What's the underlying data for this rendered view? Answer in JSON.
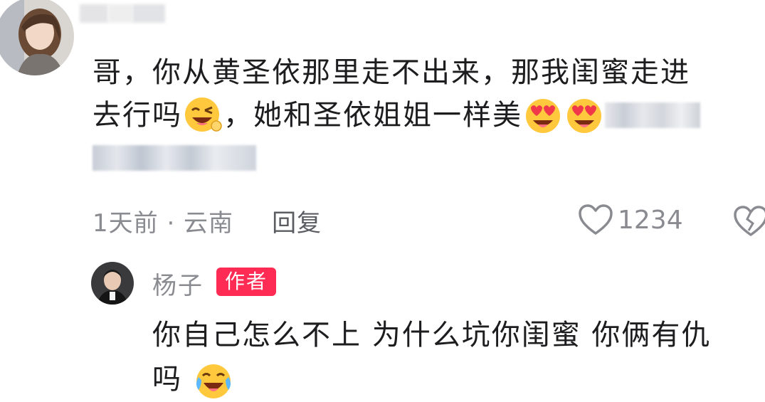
{
  "comment": {
    "avatar_icon": "user-avatar",
    "username_blurred": "",
    "text_line1": "哥，你从黄圣依那里走不出来，那我闺蜜走进",
    "text_line2_part1": "去行吗",
    "emoji1": "wink-laugh-emoji",
    "text_line2_part2": "，她和圣依姐姐一样美",
    "emoji2": "heart-eyes-emoji",
    "emoji3": "heart-eyes-emoji",
    "time_location": "1天前 · 云南",
    "reply_label": "回复",
    "like_count": "1234",
    "like_icon": "heart-outline-icon",
    "dislike_icon": "broken-heart-icon"
  },
  "reply": {
    "avatar_icon": "user-avatar",
    "username": "杨子",
    "badge": "作者",
    "text_line1": "你自己怎么不上 为什么坑你闺蜜 你俩有仇",
    "text_line2": "吗",
    "emoji": "laugh-crying-emoji"
  },
  "colors": {
    "badge_bg": "#fe2c55",
    "meta_gray": "#8a8b91",
    "text": "#1d1d1f"
  }
}
